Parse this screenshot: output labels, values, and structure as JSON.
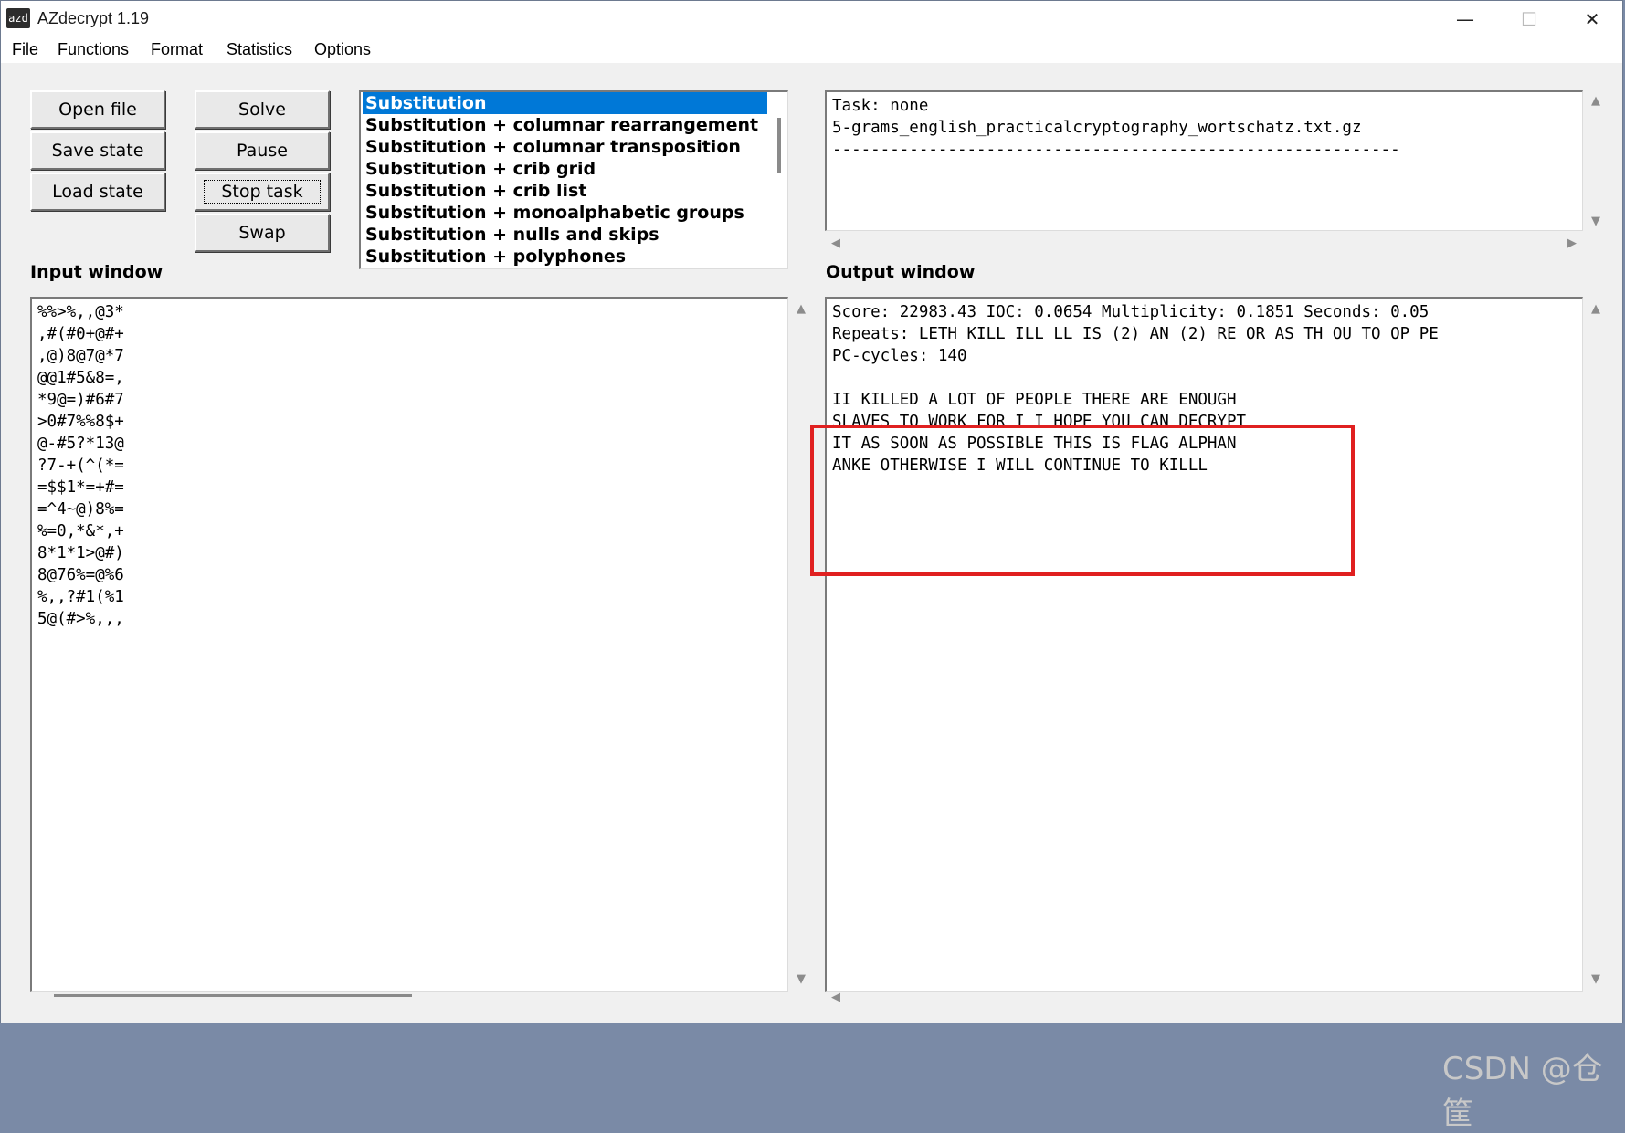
{
  "window": {
    "app_icon_text": "azd",
    "title": "AZdecrypt 1.19",
    "controls": {
      "minimize": "—",
      "maximize": "☐",
      "close": "✕"
    }
  },
  "menu": [
    "File",
    "Functions",
    "Format",
    "Statistics",
    "Options"
  ],
  "buttons": {
    "open_file": "Open file",
    "save_state": "Save state",
    "load_state": "Load state",
    "solve": "Solve",
    "pause": "Pause",
    "stop_task": "Stop task",
    "swap": "Swap"
  },
  "solver_list": {
    "selected": "Substitution",
    "items": [
      "Substitution",
      "Substitution + columnar rearrangement",
      "Substitution + columnar transposition",
      "Substitution + crib grid",
      "Substitution + crib list",
      "Substitution + monoalphabetic groups",
      "Substitution + nulls and skips",
      "Substitution + polyphones"
    ]
  },
  "status": {
    "lines": [
      "Task: none",
      "5-grams_english_practicalcryptography_wortschatz.txt.gz",
      "-----------------------------------------------------------"
    ]
  },
  "input_window": {
    "label": "Input window",
    "lines": [
      "%%>%,,@3*",
      ",#(#0+@#+",
      ",@)8@7@*7",
      "@@1#5&8=,",
      "*9@=)#6#7",
      ">0#7%%8$+",
      "@-#5?*13@",
      "?7-+(^(*=",
      "=$$1*=+#=",
      "=^4~@)8%=",
      "%=0,*&*,+",
      "8*1*1>@#)",
      "8@76%=@%6",
      "%,,?#1(%1",
      "5@(#>%,,,"
    ]
  },
  "output_window": {
    "label": "Output window",
    "lines": [
      "Score: 22983.43 IOC: 0.0654 Multiplicity: 0.1851 Seconds: 0.05",
      "Repeats: LETH KILL ILL LL IS (2) AN (2) RE OR AS TH OU TO OP PE",
      "PC-cycles: 140",
      "",
      "II KILLED A LOT OF PEOPLE THERE ARE ENOUGH",
      "SLAVES TO WORK FOR I I HOPE YOU CAN DECRYPT",
      "IT AS SOON AS POSSIBLE THIS IS FLAG ALPHAN",
      "ANKE OTHERWISE I WILL CONTINUE TO KILLL"
    ]
  },
  "annotation": {
    "color": "#e02020"
  },
  "watermark": "CSDN @仓筐",
  "colors": {
    "selection": "#0078d7",
    "face": "#f0f0f0"
  }
}
